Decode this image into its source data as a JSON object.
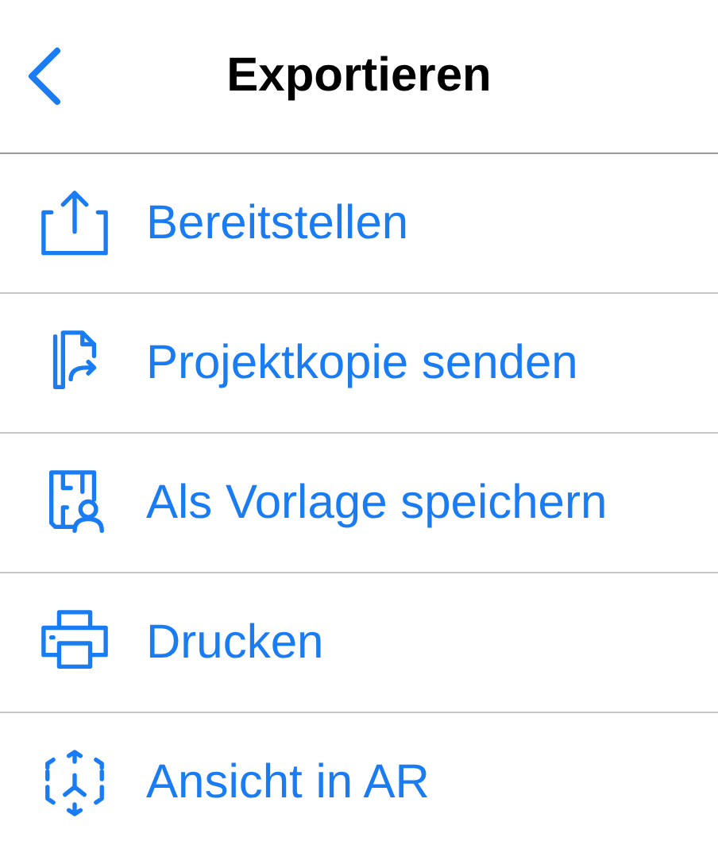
{
  "navigation_bar": {
    "title": "Exportieren"
  },
  "items": [
    {
      "kind": "share",
      "label": "Bereitstellen"
    },
    {
      "kind": "copy",
      "label": "Projektkopie senden"
    },
    {
      "kind": "template",
      "label": "Als Vorlage speichern"
    },
    {
      "kind": "print",
      "label": "Drucken"
    },
    {
      "kind": "ar",
      "label": "Ansicht in AR"
    }
  ]
}
